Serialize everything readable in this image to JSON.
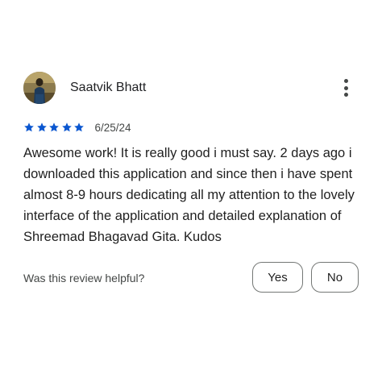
{
  "review": {
    "reviewer_name": "Saatvik Bhatt",
    "rating": 5,
    "max_rating": 5,
    "date": "6/25/24",
    "text": "Awesome work! It is really good i must say. 2 days ago i downloaded this application and since then i have spent almost 8-9 hours dedicating all my attention to the lovely interface of the application and detailed explanation of Shreemad Bhagavad Gita. Kudos",
    "star_color": "#0b57d0"
  },
  "helpful": {
    "prompt": "Was this review helpful?",
    "yes_label": "Yes",
    "no_label": "No"
  },
  "icons": {
    "more": "more-vert-icon",
    "star": "star-icon",
    "avatar": "avatar-image"
  }
}
